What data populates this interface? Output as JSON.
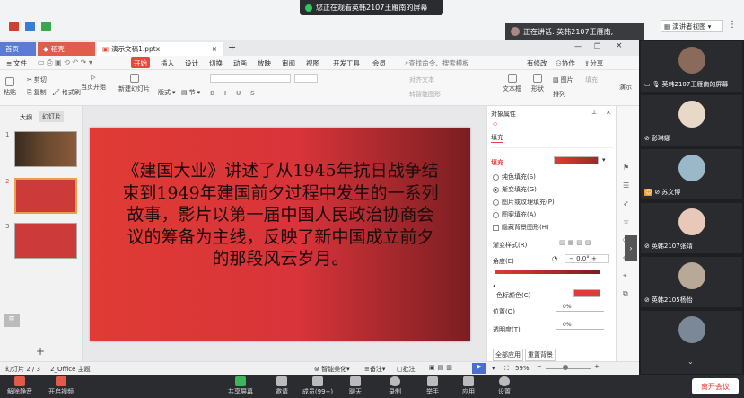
{
  "banner": {
    "text": "您正在观看英韩2107王雁南的屏幕"
  },
  "speaker": {
    "text": "正在讲话: 英韩2107王雁南;"
  },
  "view": {
    "label": "演讲者视图"
  },
  "tabs": {
    "home": "首页",
    "shell": "稻壳",
    "doc": "演示文稿1.pptx"
  },
  "menu": [
    "文件",
    "开始",
    "插入",
    "设计",
    "切换",
    "动画",
    "放映",
    "审阅",
    "视图",
    "开发工具",
    "会员"
  ],
  "search": {
    "placeholder": "查找命令、搜索模板"
  },
  "account": {
    "unsaved": "有修改",
    "collab": "协作",
    "share": "分享"
  },
  "ribbon": {
    "paste": "粘贴",
    "cut": "剪切",
    "copy": "复制",
    "format": "格式刷",
    "from_start": "当页开始",
    "new_slide": "新建幻灯片",
    "layout": "版式",
    "section": "节",
    "textbox": "文本框",
    "shape": "形状",
    "arrange": "排列",
    "picture": "图片",
    "fill": "填充",
    "text_dir": "对齐文本",
    "smart": "转智能图形",
    "present": "演示"
  },
  "leftpane": {
    "outline": "大纲",
    "slides": "幻灯片",
    "add": "+"
  },
  "slides": [
    "1",
    "2",
    "3"
  ],
  "slide_text": "《建国大业》讲述了从1945年抗日战争结束到1949年建国前夕过程中发生的一系列故事，影片以第一届中国人民政治协商会议的筹备为主线，反映了新中国成立前夕的那段风云岁月。",
  "prop": {
    "title": "对象属性",
    "fill_tab": "填充",
    "fill_label": "填充",
    "options": [
      "纯色填充(S)",
      "渐变填充(G)",
      "图片或纹理填充(P)",
      "图案填充(A)"
    ],
    "hide_bg": "隐藏背景图形(H)",
    "gradient_style": "渐变样式(R)",
    "angle_label": "角度(E)",
    "angle_value": "0.0°",
    "stop_color": "色标颜色(C)",
    "position": "位置(O)",
    "pos_value": "0%",
    "transparency": "透明度(T)",
    "trans_value": "0%",
    "apply_all": "全部应用",
    "reset_bg": "重置背景",
    "fill_color": "#e03b34"
  },
  "status": {
    "slide_idx": "幻灯片 2 / 3",
    "theme": "2_Office 主题",
    "beautify": "智能美化",
    "notes": "备注",
    "comment": "批注",
    "zoom": "59%"
  },
  "participants": [
    {
      "name": "英韩2107王雁南的屏幕",
      "face": "#8a6a5a"
    },
    {
      "name": "彭琳娜",
      "face": "#e8d8c8"
    },
    {
      "name": "苏文博",
      "face": "#9ab8c8"
    },
    {
      "name": "英韩2107张靖",
      "face": "#e8c8b8"
    },
    {
      "name": "英韩2105杨怡",
      "face": "#b8a898"
    },
    {
      "name": "",
      "face": "#7a8898"
    }
  ],
  "toolbar": [
    {
      "id": "mute",
      "label": "解除静音"
    },
    {
      "id": "video",
      "label": "开启视频"
    },
    {
      "id": "share",
      "label": "共享屏幕"
    },
    {
      "id": "invite",
      "label": "邀请"
    },
    {
      "id": "members",
      "label": "成员(99+)"
    },
    {
      "id": "chat",
      "label": "聊天"
    },
    {
      "id": "record",
      "label": "录制"
    },
    {
      "id": "hand",
      "label": "举手"
    },
    {
      "id": "apps",
      "label": "应用"
    },
    {
      "id": "settings",
      "label": "设置"
    }
  ],
  "leave": "离开会议"
}
